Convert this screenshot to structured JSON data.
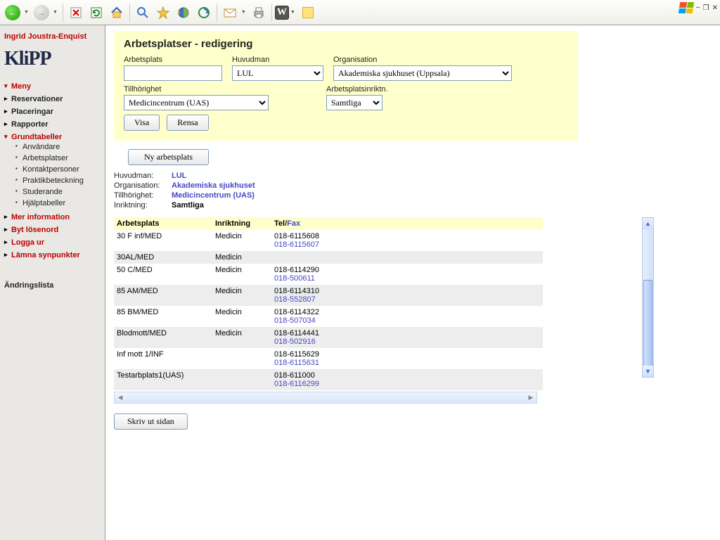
{
  "toolbar": {
    "back_icon": "back",
    "fwd_icon": "forward",
    "stop_icon": "stop",
    "refresh_icon": "refresh",
    "home_icon": "home",
    "search_icon": "search",
    "fav_icon": "favorites",
    "globe_icon": "globe-arrow",
    "sync_icon": "sync",
    "mail_icon": "mail",
    "print_icon": "print",
    "word_icon": "W",
    "note_icon": "note"
  },
  "sidebar": {
    "username": "Ingrid Joustra-Enquist",
    "logo": "KliPP",
    "items": [
      {
        "label": "Meny",
        "kind": "red-open"
      },
      {
        "label": "Reservationer",
        "kind": "top"
      },
      {
        "label": "Placeringar",
        "kind": "top"
      },
      {
        "label": "Rapporter",
        "kind": "top"
      },
      {
        "label": "Grundtabeller",
        "kind": "red-open",
        "children": [
          {
            "label": "Användare"
          },
          {
            "label": "Arbetsplatser"
          },
          {
            "label": "Kontaktpersoner"
          },
          {
            "label": "Praktikbeteckning"
          },
          {
            "label": "Studerande"
          },
          {
            "label": "Hjälptabeller"
          }
        ]
      },
      {
        "label": "Mer information",
        "kind": "red"
      },
      {
        "label": "Byt lösenord",
        "kind": "red"
      },
      {
        "label": "Logga ur",
        "kind": "red"
      },
      {
        "label": "Lämna synpunkter",
        "kind": "red"
      }
    ],
    "changelog": "Ändringslista"
  },
  "panel": {
    "title": "Arbetsplatser - redigering",
    "arbetsplats_label": "Arbetsplats",
    "arbetsplats_value": "",
    "huvudman_label": "Huvudman",
    "huvudman_value": "LUL",
    "organisation_label": "Organisation",
    "organisation_value": "Akademiska sjukhuset (Uppsala)",
    "tillhorighet_label": "Tillhörighet",
    "tillhorighet_value": "Medicincentrum (UAS)",
    "inriktn_label": "Arbetsplatsinriktn.",
    "inriktn_value": "Samtliga",
    "visa_btn": "Visa",
    "rensa_btn": "Rensa"
  },
  "new_btn": "Ny arbetsplats",
  "info": {
    "huvudman_lbl": "Huvudman:",
    "huvudman_val": "LUL",
    "organisation_lbl": "Organisation:",
    "organisation_val": "Akademiska sjukhuset",
    "tillhorighet_lbl": "Tillhörighet:",
    "tillhorighet_val": "Medicincentrum (UAS)",
    "inriktning_lbl": "Inriktning:",
    "inriktning_val": "Samtliga"
  },
  "table": {
    "col_arbetsplats": "Arbetsplats",
    "col_inriktning": "Inriktning",
    "col_tel": "Tel",
    "col_slash": "/",
    "col_fax": "Fax",
    "rows": [
      {
        "a": "30 F inf/MED",
        "i": "Medicin",
        "t": "018-6115608",
        "f": "018-6115607"
      },
      {
        "a": "30AL/MED",
        "i": "Medicin",
        "t": "",
        "f": ""
      },
      {
        "a": "50 C/MED",
        "i": "Medicin",
        "t": "018-6114290",
        "f": "018-500611"
      },
      {
        "a": "85 AM/MED",
        "i": "Medicin",
        "t": "018-6114310",
        "f": "018-552807"
      },
      {
        "a": "85 BM/MED",
        "i": "Medicin",
        "t": "018-6114322",
        "f": "018-507034"
      },
      {
        "a": "Blodmott/MED",
        "i": "Medicin",
        "t": "018-6114441",
        "f": "018-502916"
      },
      {
        "a": "Inf mott 1/INF",
        "i": "",
        "t": "018-6115629",
        "f": "018-6115631"
      },
      {
        "a": "Testarbplats1(UAS)",
        "i": "",
        "t": "018-611000",
        "f": "018-6116299"
      }
    ]
  },
  "print_btn": "Skriv ut sidan"
}
